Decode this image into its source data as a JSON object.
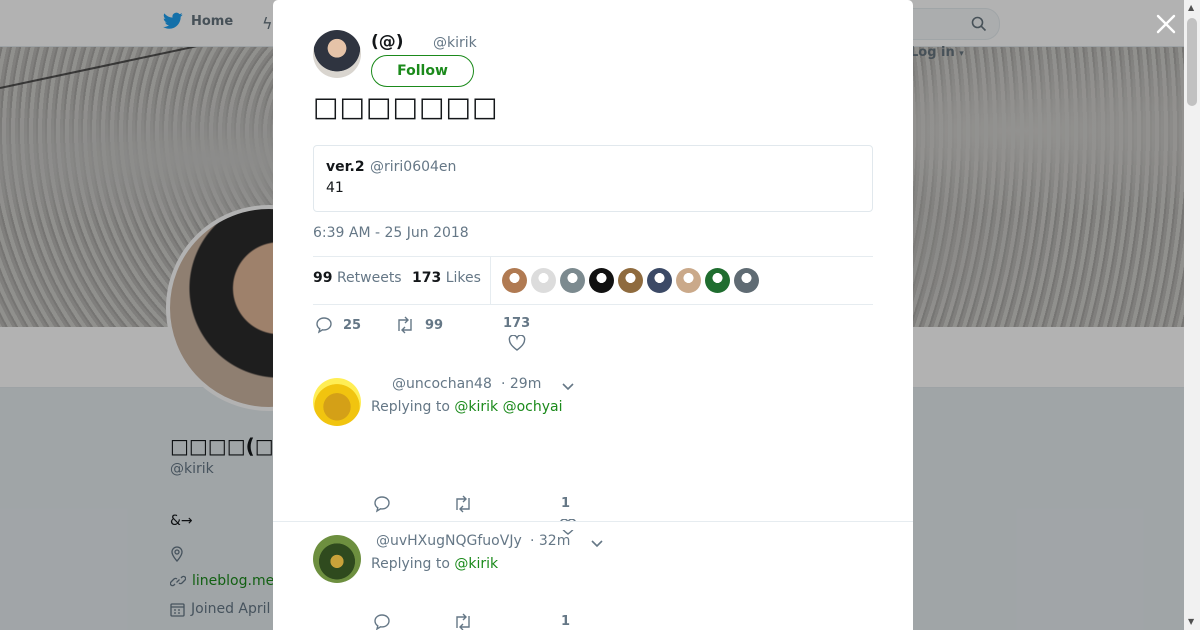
{
  "background": {
    "nav": {
      "home_label": "Home",
      "login_label": "Log in"
    },
    "profile": {
      "name": "□□□□(□□□□",
      "handle": "@kirik",
      "bio": "&→",
      "website": "lineblog.me",
      "joined": "Joined April"
    }
  },
  "tweet": {
    "author_name": "(@)",
    "author_handle": "@kirik",
    "follow_label": "Follow",
    "text": "□□□□□□□",
    "quote": {
      "name": "ver.2",
      "handle": "@riri0604en",
      "text": "41"
    },
    "timestamp": "6:39 AM - 25 Jun 2018",
    "stats": {
      "retweets_count": "99",
      "retweets_label": "Retweets",
      "likes_count": "173",
      "likes_label": "Likes"
    },
    "likers": [
      "#b07a52",
      "#dcdcdc",
      "#7c8a8f",
      "#111111",
      "#8f6b3e",
      "#3c4a66",
      "#caa98a",
      "#1f6d2f",
      "#5f6b73"
    ],
    "actions": {
      "replies": "25",
      "retweets": "99",
      "likes": "173"
    }
  },
  "replies": [
    {
      "handle": "@uncochan48",
      "time": "· 29m",
      "replying_prefix": "Replying to",
      "replying_to": "@kirik @ochyai",
      "likes": "1",
      "avatar_color": "#f1c40f"
    },
    {
      "handle": "@uvHXugNQGfuoVJy",
      "time": "· 32m",
      "replying_prefix": "Replying to",
      "replying_to": "@kirik",
      "likes": "1",
      "avatar_color": "#4a6b2a"
    }
  ],
  "colors": {
    "accent": "#1b8a1b",
    "twitter_blue": "#1da1f2",
    "muted": "#657786"
  }
}
